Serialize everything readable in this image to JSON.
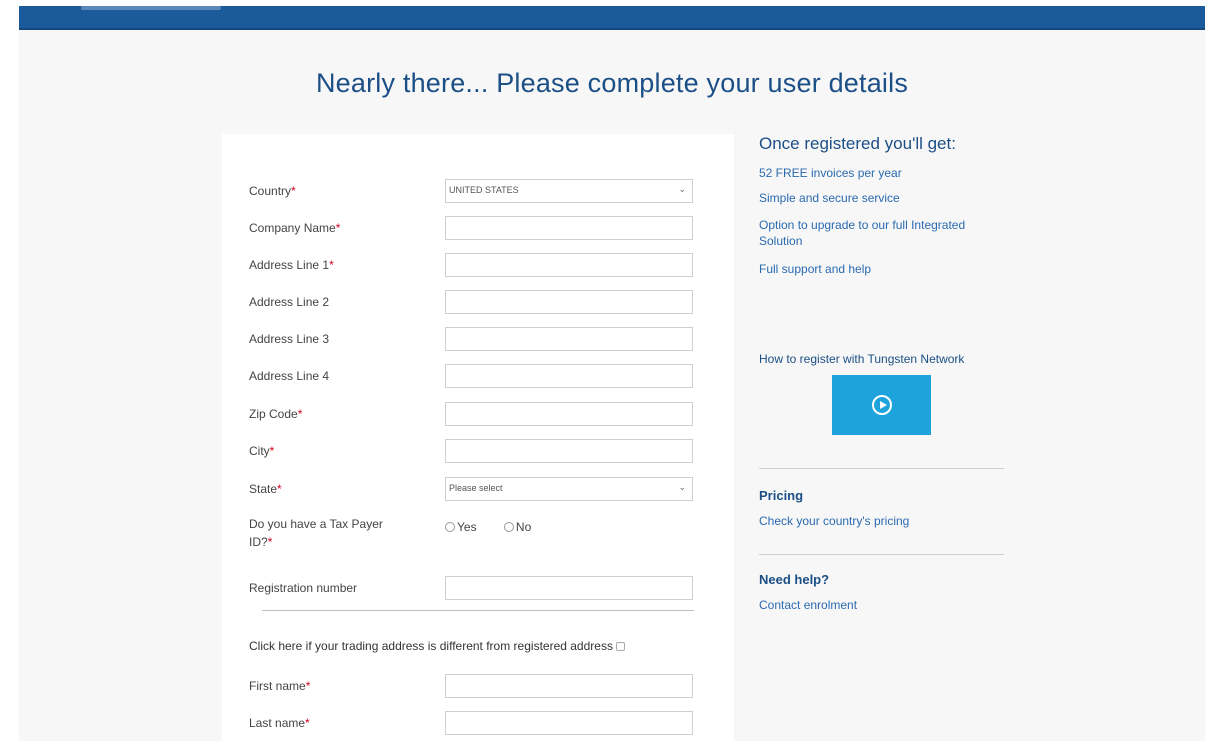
{
  "heading": "Nearly there... Please complete your user details",
  "form": {
    "country": {
      "label": "Country",
      "value": "UNITED STATES"
    },
    "company_name": {
      "label": "Company Name"
    },
    "address1": {
      "label": "Address Line 1"
    },
    "address2": {
      "label": "Address Line 2"
    },
    "address3": {
      "label": "Address Line 3"
    },
    "address4": {
      "label": "Address Line 4"
    },
    "zip": {
      "label": "Zip Code"
    },
    "city": {
      "label": "City"
    },
    "state": {
      "label": "State",
      "value": "Please select"
    },
    "tax_payer": {
      "label_line1": "Do you have a Tax Payer",
      "label_line2": "ID?",
      "yes": "Yes",
      "no": "No"
    },
    "registration": {
      "label": "Registration number"
    },
    "trading_address": "Click here if your trading address is different from registered address",
    "first_name": {
      "label": "First name"
    },
    "last_name": {
      "label": "Last name"
    },
    "required_marker": "*"
  },
  "sidebar": {
    "title": "Once registered you'll get:",
    "benefits": [
      "52 FREE invoices per year",
      "Simple and secure service",
      "Option to upgrade to our full Integrated Solution",
      "Full support and help"
    ],
    "video_label": "How to register with Tungsten Network",
    "pricing_heading": "Pricing",
    "pricing_link": "Check your country's pricing",
    "help_heading": "Need help?",
    "help_link": "Contact enrolment"
  },
  "icons": {
    "play": "play-circle-icon",
    "chevron": "chevron-down-icon"
  },
  "colors": {
    "brand": "#1b5a9b",
    "heading": "#1b4f86",
    "link": "#2a6ab0",
    "video": "#1fa3dc",
    "required": "#d0021b"
  }
}
